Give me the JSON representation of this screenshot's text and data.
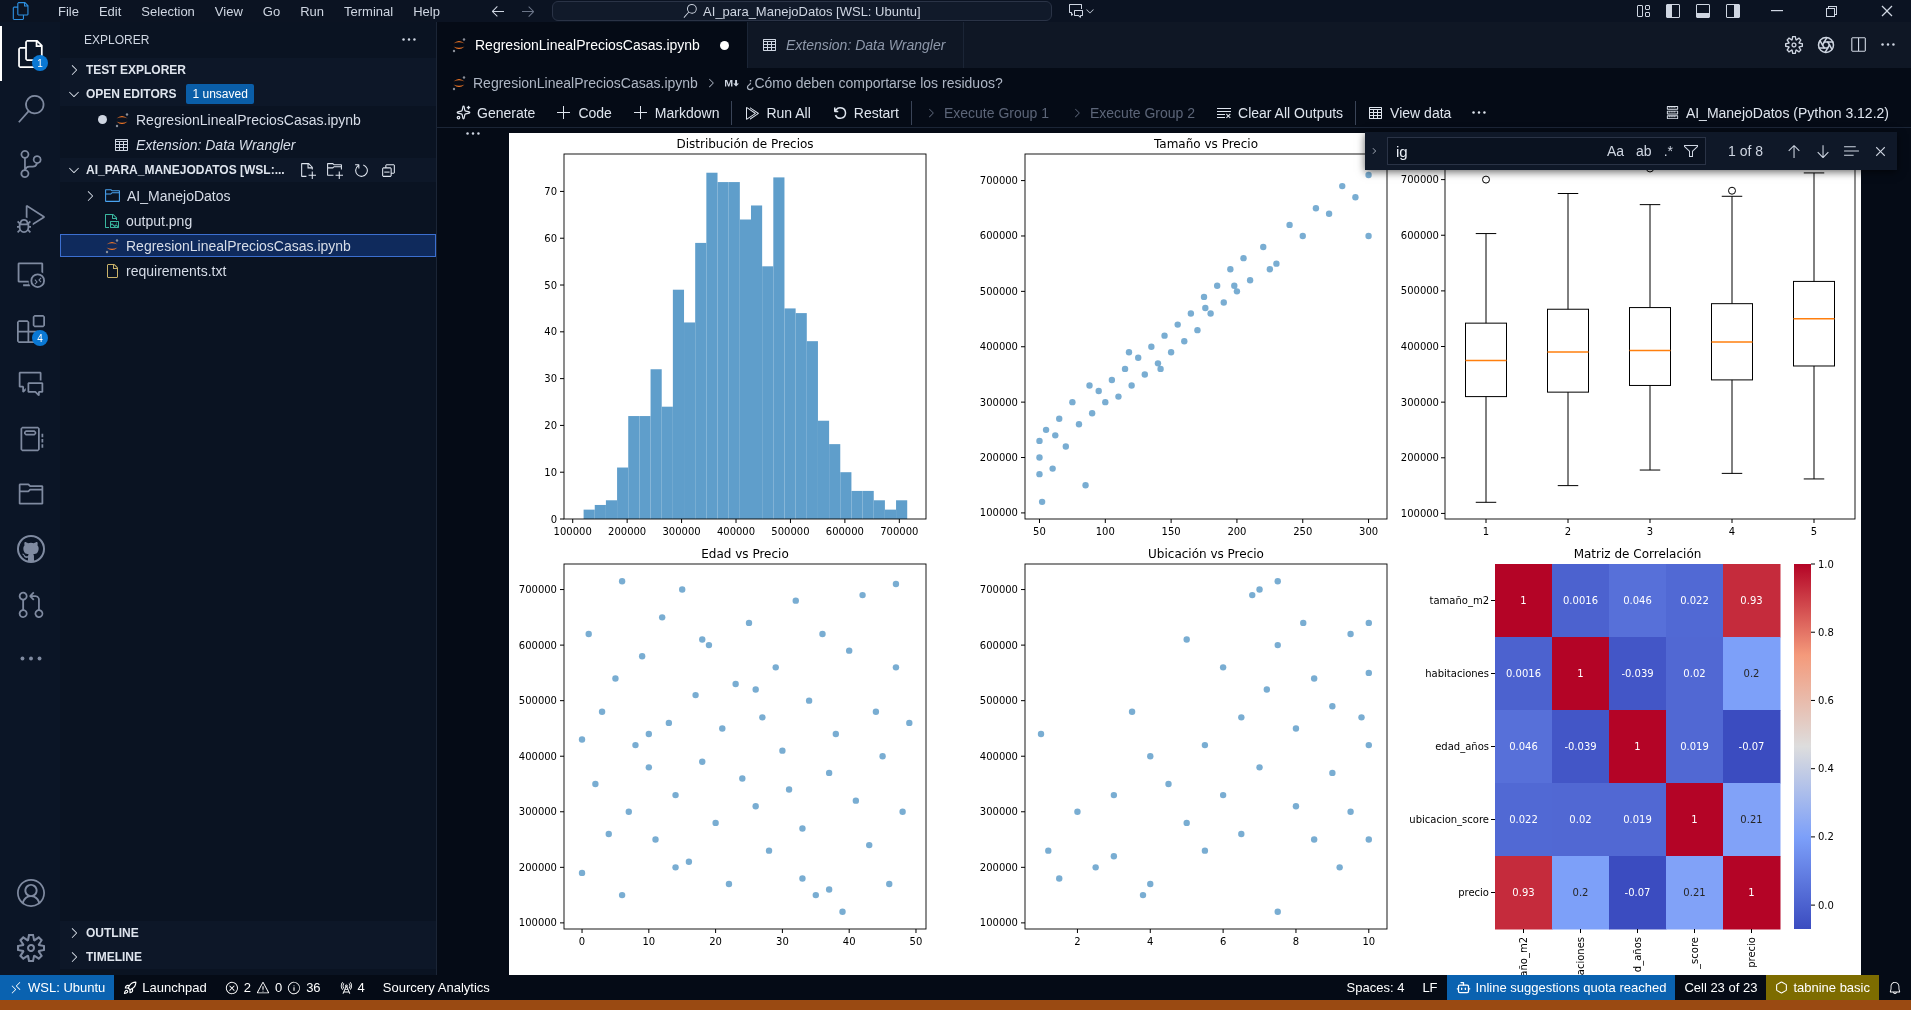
{
  "title_bar": {
    "menu": [
      "File",
      "Edit",
      "Selection",
      "View",
      "Go",
      "Run",
      "Terminal",
      "Help"
    ],
    "command_center": "AI_para_ManejoDatos [WSL: Ubuntu]"
  },
  "activity_bar": {
    "items": [
      {
        "kind": "explorer",
        "selected": true,
        "badge": "1"
      },
      {
        "kind": "search",
        "selected": false
      },
      {
        "kind": "scm",
        "selected": false
      },
      {
        "kind": "debug",
        "selected": false
      },
      {
        "kind": "remote",
        "selected": false
      },
      {
        "kind": "extensions",
        "selected": false,
        "badge": "4"
      },
      {
        "kind": "chat",
        "selected": false
      },
      {
        "kind": "notebook",
        "selected": false
      },
      {
        "kind": "folder",
        "selected": false
      },
      {
        "kind": "github",
        "selected": false
      },
      {
        "kind": "pr",
        "selected": false
      },
      {
        "kind": "more",
        "selected": false
      }
    ],
    "bottom": [
      {
        "kind": "account",
        "selected": false
      },
      {
        "kind": "settings",
        "selected": false
      }
    ]
  },
  "sidebar": {
    "title": "EXPLORER",
    "sections": [
      {
        "kind": "panel",
        "title": "TEST EXPLORER",
        "expanded": false
      },
      {
        "kind": "panel",
        "title": "OPEN EDITORS",
        "expanded": true,
        "badge": "1 unsaved",
        "items": [
          {
            "kind": "notebook",
            "label": "RegresionLinealPreciosCasas.ipynb",
            "modified": true,
            "preview": false
          },
          {
            "kind": "wrangler",
            "label": "Extension: Data Wrangler",
            "modified": false,
            "preview": true
          }
        ]
      },
      {
        "kind": "workspace",
        "title": "AI_PARA_MANEJODATOS [WSL:...",
        "expanded": true,
        "items": [
          {
            "kind": "folder",
            "label": "AI_ManejoDatos",
            "selected": false,
            "expanded": false
          },
          {
            "kind": "image",
            "label": "output.png",
            "selected": false
          },
          {
            "kind": "notebook",
            "label": "RegresionLinealPreciosCasas.ipynb",
            "selected": true
          },
          {
            "kind": "text",
            "label": "requirements.txt",
            "selected": false
          }
        ]
      }
    ],
    "bottom_sections": [
      {
        "title": "OUTLINE",
        "expanded": false
      },
      {
        "title": "TIMELINE",
        "expanded": false
      }
    ]
  },
  "tabs": [
    {
      "kind": "notebook",
      "label": "RegresionLinealPreciosCasas.ipynb",
      "selected": true,
      "modified": true,
      "preview": false
    },
    {
      "kind": "wrangler",
      "label": "Extension: Data Wrangler",
      "selected": false,
      "modified": false,
      "preview": true
    }
  ],
  "breadcrumb": [
    {
      "kind": "notebook",
      "label": "RegresionLinealPreciosCasas.ipynb"
    },
    {
      "kind": "markdown",
      "label": "¿Cómo deben comportarse los residuos?"
    }
  ],
  "toolbar": {
    "items": [
      {
        "kind": "generate",
        "label": "Generate",
        "disabled": false,
        "separator_before": false
      },
      {
        "kind": "add",
        "label": "Code",
        "disabled": false,
        "separator_before": false
      },
      {
        "kind": "add",
        "label": "Markdown",
        "disabled": false,
        "separator_before": false
      },
      {
        "kind": "run",
        "label": "Run All",
        "disabled": false,
        "separator_before": true
      },
      {
        "kind": "restart",
        "label": "Restart",
        "disabled": false,
        "separator_before": false
      },
      {
        "kind": "execute",
        "label": "Execute Group 1",
        "disabled": true,
        "separator_before": true
      },
      {
        "kind": "execute",
        "label": "Execute Group 2",
        "disabled": true,
        "separator_before": false
      },
      {
        "kind": "clear",
        "label": "Clear All Outputs",
        "disabled": false,
        "separator_before": false
      },
      {
        "kind": "data",
        "label": "View data",
        "disabled": false,
        "separator_before": true
      }
    ],
    "kernel": "AI_ManejoDatos (Python 3.12.2)"
  },
  "find_widget": {
    "query": "ig",
    "toggles": [
      "Aa",
      "ab",
      ".*"
    ],
    "result": "1 of 8"
  },
  "output": {
    "charts": [
      {
        "chart_data": {
          "type": "bar",
          "title": "Distribución de Precios",
          "x": [
            130250,
            150750,
            171250,
            191750,
            212250,
            232750,
            253250,
            273750,
            294250,
            314750,
            335250,
            355750,
            376250,
            396750,
            417250,
            437750,
            458250,
            478750,
            499250,
            519750,
            540250,
            560750,
            581250,
            601750,
            622250,
            642750,
            663250,
            683750,
            704250
          ],
          "series": [
            {
              "color": "#5f9ecb",
              "values": [
                2,
                3,
                4,
                11,
                22,
                22,
                32,
                24,
                49,
                42,
                59,
                74,
                72,
                72,
                64,
                67,
                54,
                73,
                45,
                44,
                38,
                21,
                16,
                10,
                6,
                6,
                4,
                2,
                4
              ]
            }
          ],
          "xlim": [
            84000,
            749000
          ],
          "ylim": [
            0,
            78
          ],
          "xticks": [
            100000,
            200000,
            300000,
            400000,
            500000,
            600000,
            700000
          ],
          "yticks": [
            0,
            10,
            20,
            30,
            40,
            50,
            60,
            70
          ]
        }
      },
      {
        "chart_data": {
          "type": "scatter",
          "title": "Tamaño vs Precio",
          "x": [
            50,
            50,
            52,
            55,
            60,
            65,
            70,
            75,
            80,
            85,
            90,
            95,
            100,
            105,
            110,
            115,
            120,
            125,
            130,
            135,
            140,
            145,
            150,
            155,
            160,
            165,
            170,
            175,
            180,
            185,
            190,
            195,
            200,
            205,
            210,
            220,
            230,
            240,
            250,
            260,
            270,
            280,
            290,
            300,
            300,
            50,
            62,
            88,
            118,
            142,
            176,
            198,
            225
          ],
          "series": [
            {
              "color": "#1f77b4",
              "values": [
                200000,
                230000,
                120000,
                250000,
                180000,
                270000,
                220000,
                300000,
                260000,
                150000,
                280000,
                320000,
                300000,
                340000,
                310000,
                360000,
                330000,
                380000,
                350000,
                400000,
                370000,
                420000,
                390000,
                440000,
                410000,
                460000,
                430000,
                490000,
                460000,
                510000,
                480000,
                540000,
                500000,
                560000,
                520000,
                580000,
                550000,
                620000,
                600000,
                650000,
                640000,
                690000,
                670000,
                710000,
                600000,
                170000,
                240000,
                330000,
                390000,
                360000,
                470000,
                510000,
                540000
              ]
            }
          ],
          "xlim": [
            39,
            314
          ],
          "ylim": [
            89000,
            748000
          ],
          "xticks": [
            50,
            100,
            150,
            200,
            250,
            300
          ],
          "yticks": [
            100000,
            200000,
            300000,
            400000,
            500000,
            600000,
            700000
          ]
        }
      },
      {
        "chart_data": {
          "type": "scatter",
          "title": "Edad vs Precio",
          "x": [
            0,
            1,
            2,
            3,
            4,
            5,
            6,
            7,
            8,
            9,
            10,
            11,
            12,
            13,
            14,
            15,
            16,
            17,
            18,
            19,
            20,
            21,
            22,
            23,
            24,
            25,
            26,
            27,
            28,
            29,
            30,
            31,
            32,
            33,
            34,
            35,
            36,
            37,
            38,
            39,
            40,
            41,
            42,
            43,
            44,
            45,
            46,
            47,
            48,
            49,
            0,
            6,
            14,
            18,
            33,
            37,
            47,
            10,
            26
          ],
          "series": [
            {
              "color": "#1f77b4",
              "values": [
                190000,
                620000,
                350000,
                480000,
                260000,
                540000,
                715000,
                300000,
                420000,
                580000,
                380000,
                250000,
                650000,
                460000,
                330000,
                700000,
                210000,
                510000,
                390000,
                600000,
                280000,
                450000,
                170000,
                530000,
                360000,
                640000,
                310000,
                470000,
                230000,
                560000,
                410000,
                340000,
                680000,
                270000,
                500000,
                150000,
                620000,
                370000,
                440000,
                120000,
                590000,
                320000,
                690000,
                240000,
                480000,
                400000,
                170000,
                560000,
                300000,
                460000,
                430000,
                150000,
                200000,
                610000,
                180000,
                160000,
                710000,
                440000,
                520000
              ]
            }
          ],
          "xlim": [
            -2.7,
            51.5
          ],
          "ylim": [
            89000,
            746000
          ],
          "xticks": [
            0,
            10,
            20,
            30,
            40,
            50
          ],
          "yticks": [
            100000,
            200000,
            300000,
            400000,
            500000,
            600000,
            700000
          ]
        }
      },
      {
        "chart_data": {
          "type": "scatter",
          "title": "Ubicación vs Precio",
          "x": [
            1,
            1.2,
            1.5,
            2,
            2.5,
            3,
            3,
            3.5,
            4,
            4,
            4.5,
            5,
            5,
            5.5,
            5.5,
            6,
            6,
            6.5,
            6.5,
            7,
            7,
            7.2,
            7.5,
            7.5,
            8,
            8,
            8.2,
            8.5,
            8.5,
            9,
            9,
            9.2,
            9.5,
            9.5,
            10,
            10,
            10,
            10,
            3.8,
            6.8,
            7.5,
            9.8
          ],
          "series": [
            {
              "color": "#1f77b4",
              "values": [
                440000,
                230000,
                180000,
                300000,
                200000,
                330000,
                220000,
                480000,
                170000,
                400000,
                350000,
                610000,
                280000,
                420000,
                230000,
                560000,
                330000,
                470000,
                260000,
                700000,
                380000,
                520000,
                120000,
                600000,
                310000,
                450000,
                640000,
                250000,
                540000,
                370000,
                490000,
                200000,
                620000,
                300000,
                550000,
                250000,
                420000,
                640000,
                150000,
                690000,
                715000,
                470000
              ]
            }
          ],
          "xlim": [
            0.56,
            10.5
          ],
          "ylim": [
            89000,
            746000
          ],
          "xticks": [
            2,
            4,
            6,
            8,
            10
          ],
          "yticks": [
            100000,
            200000,
            300000,
            400000,
            500000,
            600000,
            700000
          ]
        }
      }
    ],
    "box_plot": {
      "yticks": [
        "700000",
        "600000",
        "500000",
        "400000",
        "300000",
        "200000",
        "100000"
      ],
      "xticks": [
        "1",
        "2",
        "3",
        "4",
        "5"
      ]
    },
    "heatmap": {
      "title": "Matriz de Correlación",
      "row_labels": [
        "tamaño_m2",
        "habitaciones",
        "edad_años",
        "ubicacion_score",
        "precio"
      ],
      "column_labels": [
        "año_m2",
        "aciones",
        "d_años",
        "_score",
        "precio"
      ],
      "cells": [
        [
          "1",
          "0.0016",
          "0.046",
          "0.022",
          "0.93"
        ],
        [
          "0.0016",
          "1",
          "-0.039",
          "0.02",
          "0.2"
        ],
        [
          "0.046",
          "-0.039",
          "1",
          "0.019",
          "-0.07"
        ],
        [
          "0.022",
          "0.02",
          "0.019",
          "1",
          "0.21"
        ],
        [
          "0.93",
          "0.2",
          "-0.07",
          "0.21",
          "1"
        ]
      ],
      "colorbar_ticks": [
        "1.0",
        "0.8",
        "0.6",
        "0.4",
        "0.2",
        "0.0"
      ]
    }
  },
  "status_bar": {
    "left": [
      {
        "kind": "remote",
        "label": "WSL: Ubuntu"
      },
      {
        "kind": "launchpad",
        "label": "Launchpad"
      },
      {
        "kind": "problems",
        "errors": "2",
        "warnings": "0",
        "infos": "36"
      },
      {
        "kind": "ports",
        "label": "4"
      },
      {
        "kind": "plain",
        "label": "Sourcery Analytics"
      }
    ],
    "right": [
      {
        "kind": "plain",
        "label": "Spaces: 4"
      },
      {
        "kind": "plain",
        "label": "LF"
      },
      {
        "kind": "copilot",
        "label": "Inline suggestions quota reached"
      },
      {
        "kind": "plain",
        "label": "Cell 23 of 23"
      },
      {
        "kind": "tabnine",
        "label": "tabnine basic"
      },
      {
        "kind": "bell"
      }
    ]
  }
}
